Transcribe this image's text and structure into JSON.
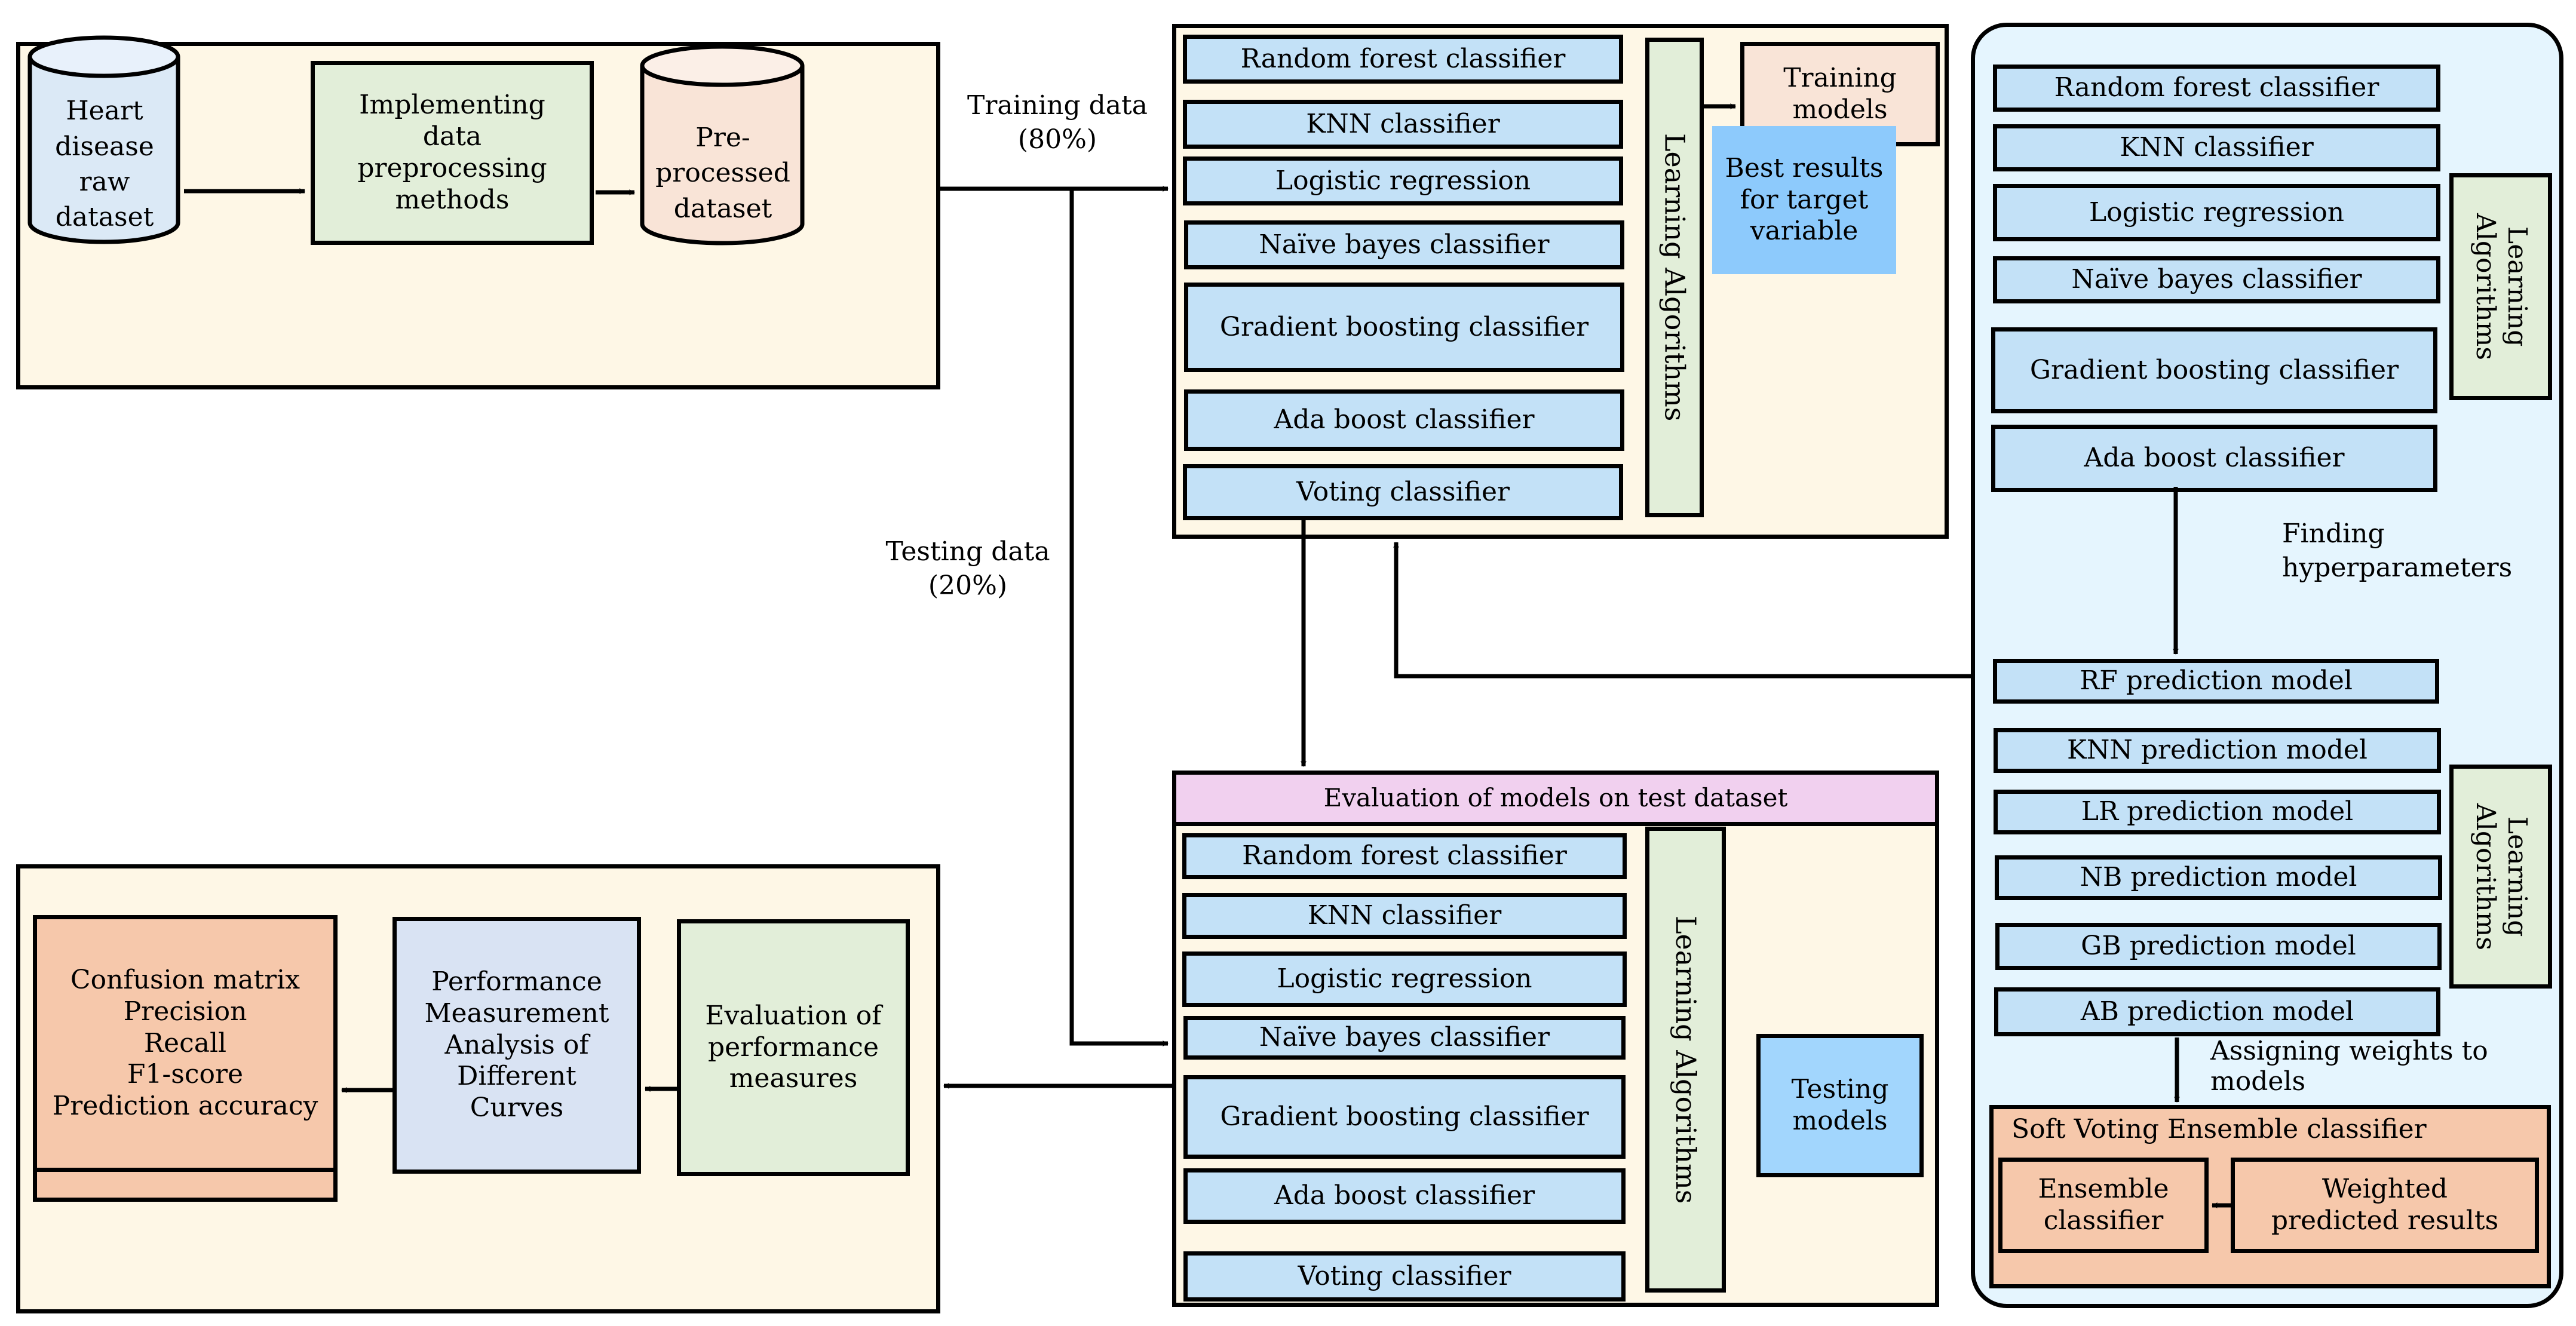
{
  "preprocessing": {
    "raw_dataset": "Heart disease\nraw dataset",
    "preprocessing_methods": "Implementing\ndata\npreprocessing\nmethods",
    "preprocessed_dataset": "Pre-processed\ndataset"
  },
  "split_labels": {
    "training": "Training data\n(80%)",
    "testing": "Testing  data\n(20%)"
  },
  "training_panel": {
    "algorithms": [
      "Random forest classifier",
      "KNN classifier",
      "Logistic regression",
      "Naïve bayes classifier",
      "Gradient boosting classifier",
      "Ada boost classifier",
      "Voting classifier"
    ],
    "learning_label": "Learning Algorithms",
    "training_models": "Training\nmodels",
    "best_results": "Best results\nfor target\nvariable"
  },
  "evaluation_panel": {
    "title": "Evaluation of models on test dataset",
    "algorithms": [
      "Random forest classifier",
      "KNN classifier",
      "Logistic regression",
      "Naïve bayes classifier",
      "Gradient boosting classifier",
      "Ada boost classifier",
      "Voting classifier"
    ],
    "learning_label": "Learning Algorithms",
    "testing_models": "Testing\nmodels"
  },
  "performance_panel": {
    "metrics": "Confusion matrix\nPrecision\nRecall\nF1-score\nPrediction accuracy",
    "curves": "Performance\nMeasurement\nAnalysis of\nDifferent\nCurves",
    "evaluation": "Evaluation of\nperformance\nmeasures"
  },
  "ensemble_panel": {
    "algorithms": [
      "Random forest classifier",
      "KNN classifier",
      "Logistic regression",
      "Naïve bayes classifier",
      "Gradient boosting classifier",
      "Ada boost classifier"
    ],
    "learning_label_top": "Learning\nAlgorithms",
    "hyperparameters": "Finding\n hyperparameters",
    "prediction_models": [
      "RF prediction model",
      "KNN prediction model",
      "LR prediction model",
      "NB prediction model",
      "GB prediction model",
      "AB prediction model"
    ],
    "learning_label_bottom": "Learning\nAlgorithms",
    "assigning_weights": "Assigning  weights to\nmodels",
    "soft_voting_title": "Soft Voting Ensemble classifier",
    "ensemble_classifier": "Ensemble\nclassifier",
    "weighted_results": "Weighted\npredicted results"
  },
  "colors": {
    "panel_bg": "#fef7e6",
    "ensemble_bg": "#e5f5fe",
    "algorithm_box": "#c3e1f7",
    "learning_box": "#e2eed9",
    "soft_voting": "#f6c8ab",
    "evaluation_header": "#f1d0ef"
  }
}
